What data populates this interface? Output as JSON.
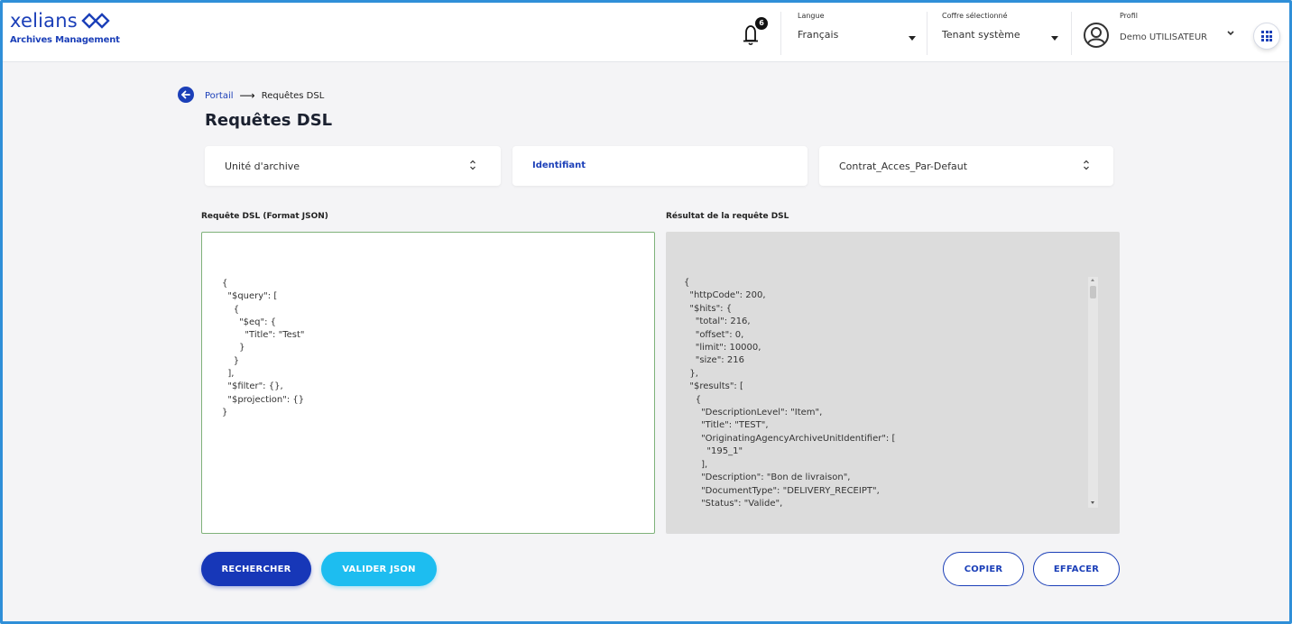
{
  "header": {
    "logo_text": "xelians",
    "logo_subtitle": "Archives Management",
    "notifications_count": "6",
    "language": {
      "label": "Langue",
      "value": "Français"
    },
    "vault": {
      "label": "Coffre sélectionné",
      "value": "Tenant système"
    },
    "profile": {
      "label": "Profil",
      "value": "Demo UTILISATEUR"
    }
  },
  "breadcrumb": {
    "link": "Portail",
    "arrow": "⟶",
    "current": "Requêtes DSL"
  },
  "page_title": "Requêtes DSL",
  "filters": {
    "collection": "Unité d'archive",
    "identifier_label": "Identifiant",
    "access_contract": "Contrat_Acces_Par-Defaut"
  },
  "query_panel": {
    "label": "Requête DSL (Format JSON)",
    "content": "{\n  \"$query\": [\n    {\n      \"$eq\": {\n        \"Title\": \"Test\"\n      }\n    }\n  ],\n  \"$filter\": {},\n  \"$projection\": {}\n}"
  },
  "result_panel": {
    "label": "Résultat de la requête DSL",
    "content": "{\n  \"httpCode\": 200,\n  \"$hits\": {\n    \"total\": 216,\n    \"offset\": 0,\n    \"limit\": 10000,\n    \"size\": 216\n  },\n  \"$results\": [\n    {\n      \"DescriptionLevel\": \"Item\",\n      \"Title\": \"TEST\",\n      \"OriginatingAgencyArchiveUnitIdentifier\": [\n        \"195_1\"\n      ],\n      \"Description\": \"Bon de livraison\",\n      \"DocumentType\": \"DELIVERY_RECEIPT\",\n      \"Status\": \"Valide\","
  },
  "buttons": {
    "search": "RECHERCHER",
    "validate": "VALIDER JSON",
    "copy": "COPIER",
    "clear": "EFFACER"
  },
  "colors": {
    "primary": "#1737b8",
    "secondary": "#1dbdf0",
    "editor_border": "#7fb27a",
    "result_bg": "#dcdcdc"
  }
}
